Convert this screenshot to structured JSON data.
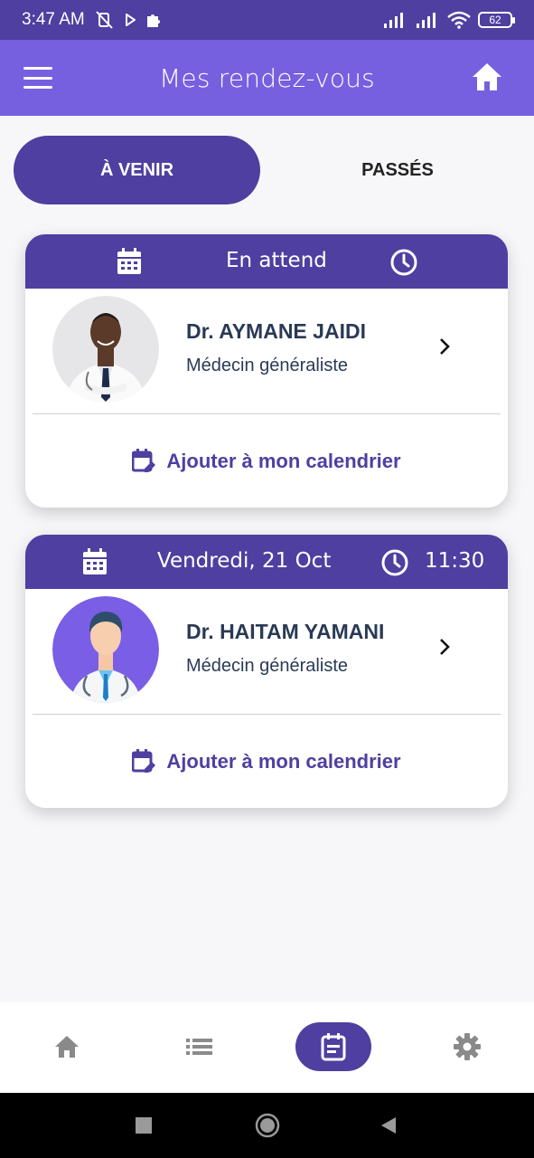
{
  "status_bar": {
    "time": "3:47 AM",
    "battery": "62"
  },
  "app_bar": {
    "title": "Mes rendez-vous",
    "menu_icon": "hamburger-menu-icon",
    "home_icon": "home-icon"
  },
  "tabs": [
    {
      "label": "À VENIR",
      "active": true
    },
    {
      "label": "PASSÉS",
      "active": false
    }
  ],
  "appointments": [
    {
      "date": "En attend",
      "time": "",
      "doctor": "Dr. AYMANE JAIDI",
      "specialty": "Médecin généraliste",
      "calendar_action": "Ajouter à mon calendrier"
    },
    {
      "date": "Vendredi, 21 Oct",
      "time": "11:30",
      "doctor": "Dr. HAITAM YAMANI",
      "specialty": "Médecin généraliste",
      "calendar_action": "Ajouter à mon calendrier"
    }
  ],
  "bottom_nav": [
    {
      "icon": "home-icon",
      "active": false
    },
    {
      "icon": "list-icon",
      "active": false
    },
    {
      "icon": "appointments-icon",
      "active": true
    },
    {
      "icon": "settings-icon",
      "active": false
    }
  ],
  "colors": {
    "primary": "#4e3fa0",
    "app_bar": "#7660e0",
    "text_dark": "#2a3a55"
  }
}
